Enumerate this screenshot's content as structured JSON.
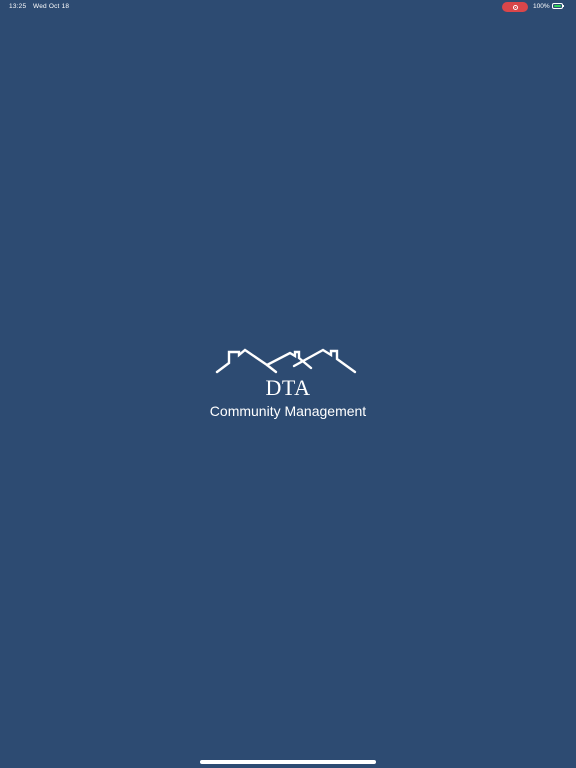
{
  "status_bar": {
    "time": "13:25",
    "date": "Wed Oct 18",
    "recording_icon": "screen-record-icon",
    "recording_color": "#d9464a",
    "battery_percent": "100%",
    "battery_icon": "battery-icon",
    "battery_color": "#2fd158"
  },
  "splash": {
    "background_color": "#2d4b72",
    "logo_icon": "houses-roofline-icon",
    "title": "DTA",
    "subtitle": "Community Management"
  },
  "home_indicator": {
    "icon": "home-indicator-bar"
  }
}
